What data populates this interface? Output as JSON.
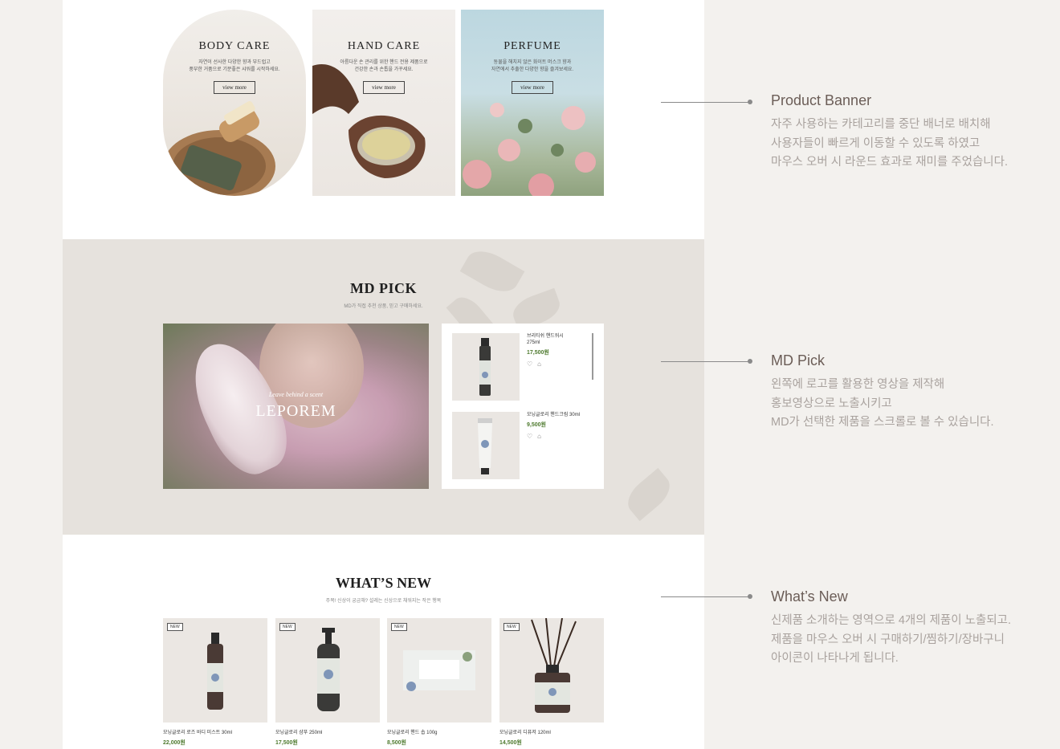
{
  "product_banner": {
    "items": [
      {
        "title": "BODY CARE",
        "desc": "자연이 선사한 다양한 향과 부드럽고\n풍부한 거품으로 기분좋은 샤워를 시작하세요.",
        "more": "view more"
      },
      {
        "title": "HAND CARE",
        "desc": "아름다운 손 관리를 위한 핸드 전용 제품으로\n건강한 손과 손톱을 가꾸세요.",
        "more": "view more"
      },
      {
        "title": "PERFUME",
        "desc": "동물을 해치지 않은 화이트 머스크 향과\n자연에서 추출한 다양한 향을 즐겨보세요.",
        "more": "view more"
      }
    ]
  },
  "md_pick": {
    "title": "MD PICK",
    "subtitle": "MD가 직접 추천 상품, 믿고 구매하세요.",
    "video": {
      "tagline": "Leave behind a scent",
      "brand": "LEPOREM"
    },
    "items": [
      {
        "name": "브리티쉬 핸드워시\n275ml",
        "price": "17,500원"
      },
      {
        "name": "모닝글로리 핸드크림 30ml",
        "price": "9,500원"
      }
    ]
  },
  "whats_new": {
    "title": "WHAT’S NEW",
    "subtitle": "주목! 신상이 궁금해? 설레는 신상으로 채워지는 작은 행복",
    "badge": "NEW",
    "items": [
      {
        "name": "모닝글로리 로즈 바디 미스트 30ml",
        "price": "22,000원"
      },
      {
        "name": "모닝글로리 샴푸 250ml",
        "price": "17,500원"
      },
      {
        "name": "모닝글로리 핸드 솝 100g",
        "price": "8,500원"
      },
      {
        "name": "모닝글로리 디퓨저 120ml",
        "price": "14,500원"
      }
    ]
  },
  "annotations": [
    {
      "title": "Product Banner",
      "desc": "자주 사용하는 카테고리를 중단 배너로 배치해\n사용자들이 빠르게 이동할 수 있도록 하였고\n마우스 오버 시 라운드 효과로 재미를 주었습니다."
    },
    {
      "title": "MD Pick",
      "desc": "왼쪽에 로고를 활용한 영상을 제작해\n홍보영상으로 노출시키고\nMD가 선택한 제품을 스크롤로 볼 수 있습니다."
    },
    {
      "title": "What’s New",
      "desc": "신제품 소개하는 영역으로 4개의 제품이 노출되고.\n제품을 마우스 오버 시 구매하기/찜하기/장바구니\n아이콘이 나타나게 됩니다."
    }
  ],
  "colors": {
    "price_green": "#4e7a2e",
    "md_bg": "#e6e2dd",
    "annotation_title": "#6b5d57",
    "annotation_text": "#a9a29e"
  }
}
